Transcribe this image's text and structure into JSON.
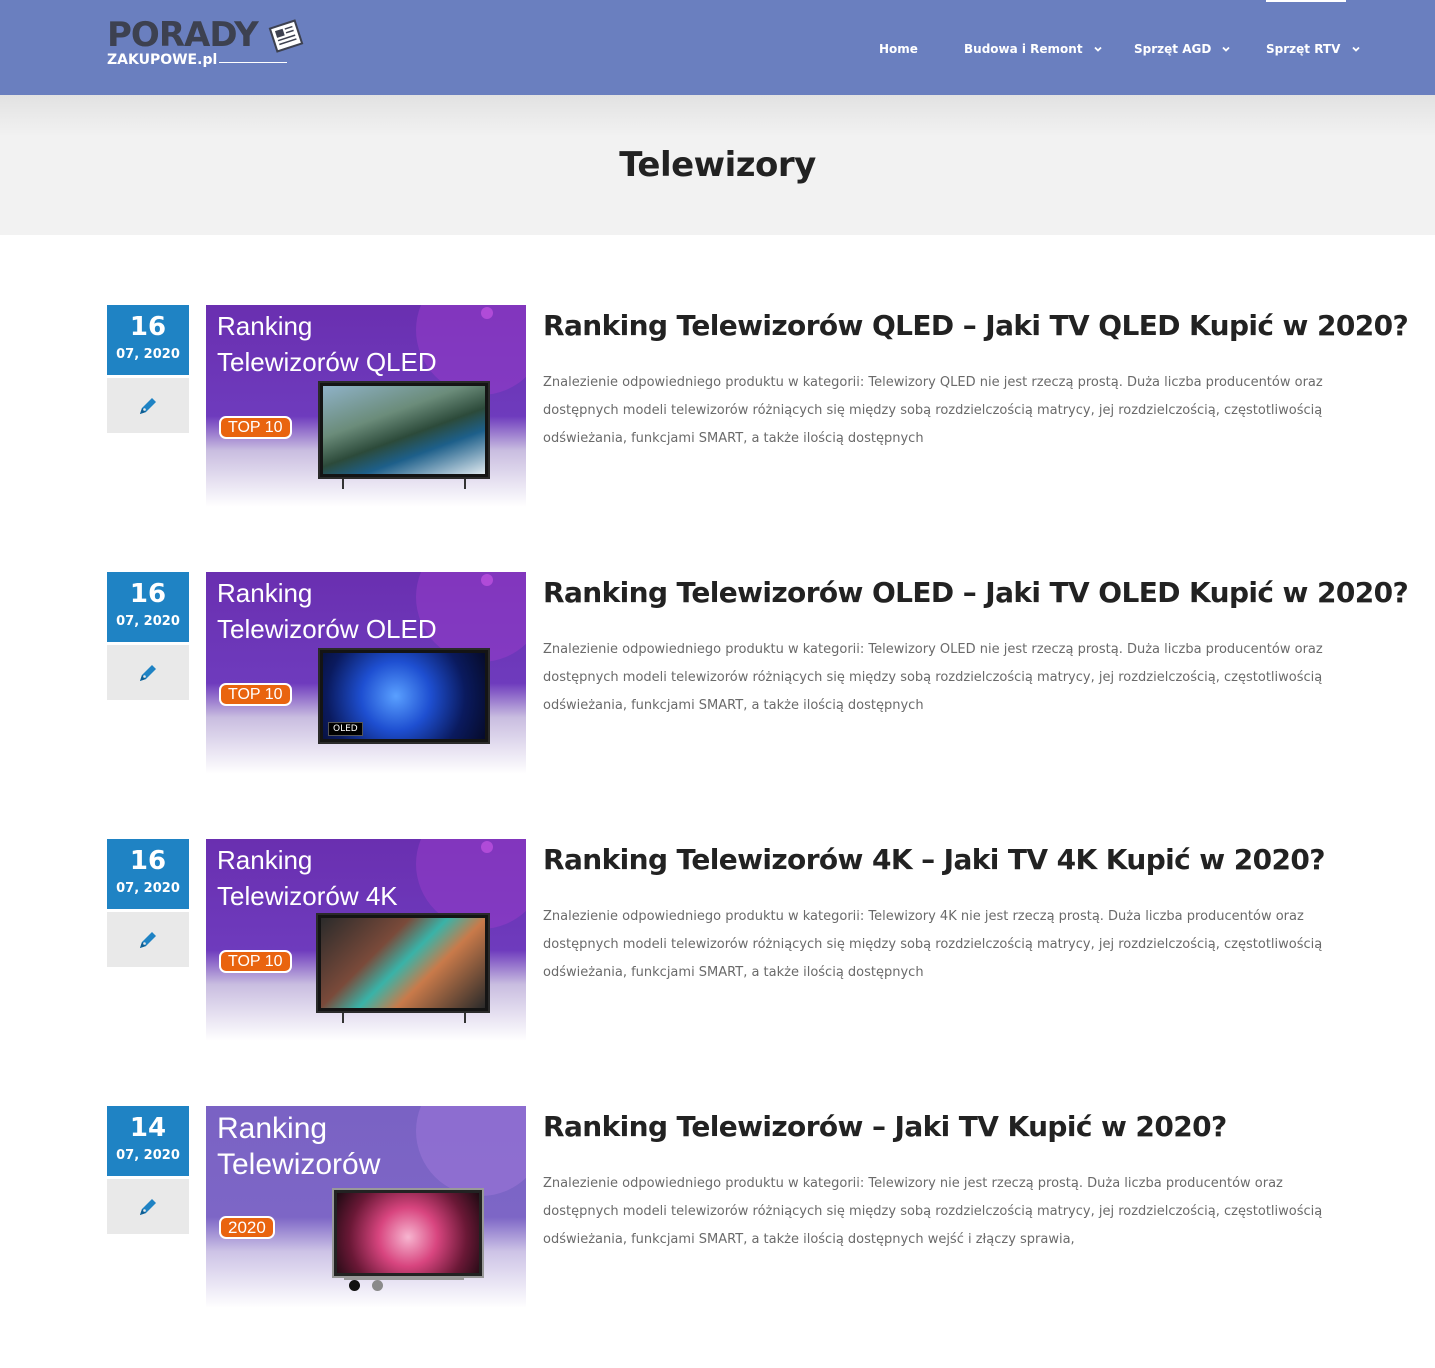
{
  "logo": {
    "main": "PORADY",
    "sub": "ZAKUPOWE.pl"
  },
  "nav": {
    "items": [
      {
        "label": "Home",
        "has_submenu": false
      },
      {
        "label": "Budowa i Remont",
        "has_submenu": true
      },
      {
        "label": "Sprzęt AGD",
        "has_submenu": true
      },
      {
        "label": "Sprzęt RTV",
        "has_submenu": true
      }
    ]
  },
  "page_title": "Telewizory",
  "posts": [
    {
      "day": "16",
      "month_year": "07, 2020",
      "thumb_line1": "Ranking",
      "thumb_line2": "Telewizorów QLED",
      "thumb_badge": "TOP 10",
      "tv_label": "",
      "title": "Ranking Telewizorów QLED – Jaki TV QLED Kupić w 2020?",
      "excerpt": "Znalezienie odpowiedniego produktu w kategorii: Telewizory QLED nie jest rzeczą prostą. Duża liczba producentów oraz dostępnych modeli telewizorów różniących się między sobą rozdzielczością matrycy, jej rozdzielczością, częstotliwością odświeżania, funkcjami SMART, a także ilością dostępnych"
    },
    {
      "day": "16",
      "month_year": "07, 2020",
      "thumb_line1": "Ranking",
      "thumb_line2": "Telewizorów OLED",
      "thumb_badge": "TOP 10",
      "tv_label": "OLED",
      "title": "Ranking Telewizorów OLED – Jaki TV OLED Kupić w 2020?",
      "excerpt": "Znalezienie odpowiedniego produktu w kategorii: Telewizory OLED nie jest rzeczą prostą. Duża liczba producentów oraz dostępnych modeli telewizorów różniących się między sobą rozdzielczością matrycy, jej rozdzielczością, częstotliwością odświeżania, funkcjami SMART, a także ilością dostępnych"
    },
    {
      "day": "16",
      "month_year": "07, 2020",
      "thumb_line1": "Ranking",
      "thumb_line2": "Telewizorów 4K",
      "thumb_badge": "TOP 10",
      "tv_label": "",
      "title": "Ranking Telewizorów 4K – Jaki TV 4K Kupić w 2020?",
      "excerpt": "Znalezienie odpowiedniego produktu w kategorii: Telewizory 4K nie jest rzeczą prostą. Duża liczba producentów oraz dostępnych modeli telewizorów różniących się między sobą rozdzielczością matrycy, jej rozdzielczością, częstotliwością odświeżania, funkcjami SMART, a także ilością dostępnych"
    },
    {
      "day": "14",
      "month_year": "07, 2020",
      "thumb_line1": "Ranking",
      "thumb_line2": "Telewizorów",
      "thumb_badge": "2020",
      "tv_label": "",
      "title": "Ranking Telewizorów – Jaki TV Kupić w 2020?",
      "excerpt": "Znalezienie odpowiedniego produktu w kategorii: Telewizory nie jest rzeczą prostą. Duża liczba producentów oraz dostępnych modeli telewizorów różniących się między sobą rozdzielczością matrycy, jej rozdzielczością, częstotliwością odświeżania, funkcjami SMART, a także ilością dostępnych wejść i złączy sprawia,"
    }
  ],
  "slider_dots": {
    "count": 2,
    "active": 1
  },
  "colors": {
    "header_bg": "#6a7fbf",
    "date_bg": "#1f83c4",
    "format_bg": "#e9e9e9",
    "badge_bg": "#e9640f",
    "title_bar_bg": "#f2f2f2"
  },
  "icons": {
    "post_format": "pen-icon",
    "submenu": "chevron-down-icon",
    "logo": "newspaper-icon"
  }
}
